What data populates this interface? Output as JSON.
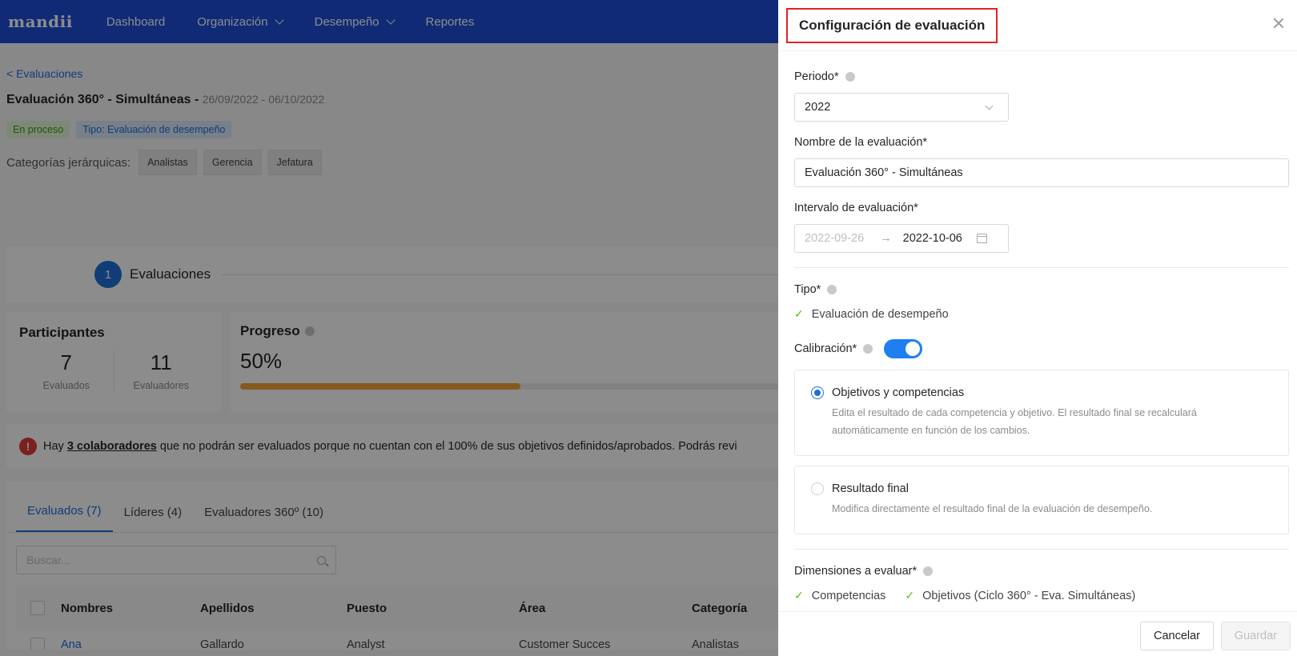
{
  "app": {
    "logo": "mandii",
    "nav": [
      {
        "label": "Dashboard"
      },
      {
        "label": "Organización"
      },
      {
        "label": "Desempeño"
      },
      {
        "label": "Reportes"
      }
    ]
  },
  "page": {
    "back_link": "< Evaluaciones",
    "title": "Evaluación 360° - Simultáneas -",
    "dates": "26/09/2022 - 06/10/2022",
    "tag_status": "En proceso",
    "tag_type": "Tipo: Evaluación de desempeño",
    "categories_label": "Categorías jerárquicas:",
    "categories": [
      "Analistas",
      "Gerencia",
      "Jefatura"
    ],
    "step_number": "1",
    "step_label": "Evaluaciones",
    "participants": {
      "title": "Participantes",
      "evaluated_count": "7",
      "evaluated_label": "Evaluados",
      "evaluators_count": "11",
      "evaluators_label": "Evaluadores"
    },
    "progress": {
      "title": "Progreso",
      "value_text": "50%",
      "value": 0.5
    },
    "alert": {
      "prefix": "Hay",
      "link": "3 colaboradores",
      "suffix": "que no podrán ser evaluados porque no cuentan con el 100% de sus objetivos definidos/aprobados. Podrás revi"
    },
    "tabs": [
      "Evaluados (7)",
      "Líderes (4)",
      "Evaluadores 360º (10)"
    ],
    "search_placeholder": "Buscar...",
    "table": {
      "headers": [
        "Nombres",
        "Apellidos",
        "Puesto",
        "Área",
        "Categoría"
      ],
      "row": [
        "Ana",
        "Gallardo",
        "Analyst",
        "Customer Succes",
        "Analistas"
      ]
    }
  },
  "drawer": {
    "title": "Configuración de evaluación",
    "period_label": "Periodo*",
    "period_value": "2022",
    "name_label": "Nombre de la evaluación*",
    "name_value": "Evaluación 360° - Simultáneas",
    "interval_label": "Intervalo de evaluación*",
    "interval_start": "2022-09-26",
    "interval_arrow": "→",
    "interval_end": "2022-10-06",
    "type_label": "Tipo*",
    "type_value": "Evaluación de desempeño",
    "calibration_label": "Calibración*",
    "calibration_on": true,
    "option1_title": "Objetivos y competencias",
    "option1_desc": "Edita el resultado de cada competencia y objetivo. El resultado final se recalculará automáticamente en función de los cambios.",
    "option2_title": "Resultado final",
    "option2_desc": "Modifica directamente el resultado final de la evaluación de desempeño.",
    "dimensions_label": "Dimensiones a evaluar*",
    "dimension1": "Competencias",
    "dimension2": "Objetivos (Ciclo 360° - Eva. Simultáneas)",
    "cancel": "Cancelar",
    "save": "Guardar"
  },
  "colors": {
    "nav_bg": "#1e4ed8",
    "accent": "#1e6fd9",
    "progress_fill": "#f2a33a",
    "highlight_border": "#e02424"
  }
}
